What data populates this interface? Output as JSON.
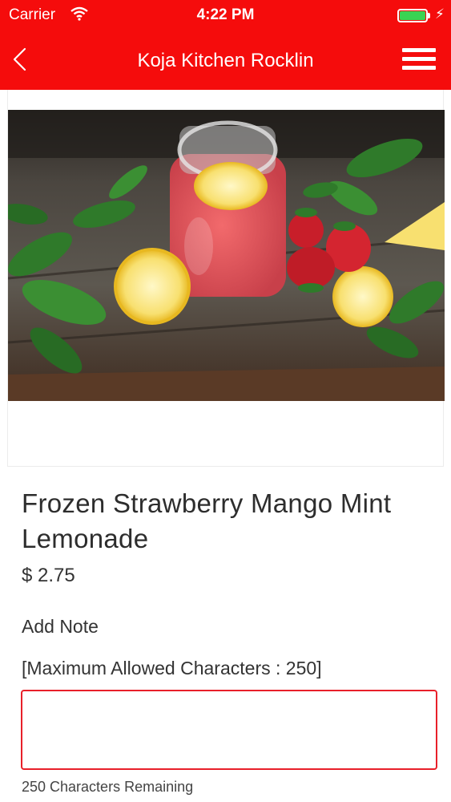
{
  "status_bar": {
    "carrier": "Carrier",
    "time": "4:22 PM",
    "icons": [
      "wifi-icon",
      "battery-icon",
      "charging-bolt-icon"
    ]
  },
  "nav": {
    "title": "Koja Kitchen Rocklin",
    "back_icon": "chevron-left-icon",
    "menu_icon": "hamburger-menu-icon"
  },
  "product": {
    "name": "Frozen Strawberry Mango Mint Lemonade",
    "price": "$ 2.75"
  },
  "note": {
    "label": "Add Note",
    "limit_text": "[Maximum Allowed Characters : 250]",
    "value": "",
    "placeholder": "",
    "remaining_text": "250 Characters Remaining"
  },
  "colors": {
    "brand_red": "#f50c0c",
    "input_border": "#e8202a",
    "battery_green": "#39d353"
  }
}
